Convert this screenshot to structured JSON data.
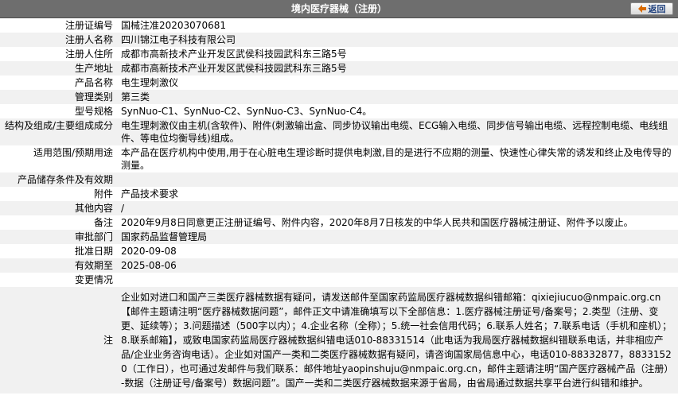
{
  "header": {
    "title": "境内医疗器械（注册）",
    "back_label": "返回"
  },
  "rows": [
    {
      "label": "注册证编号",
      "value": "国械注准20203070681"
    },
    {
      "label": "注册人名称",
      "value": "四川锦江电子科技有限公司"
    },
    {
      "label": "注册人住所",
      "value": "成都市高新技术产业开发区武侯科技园武科东三路5号"
    },
    {
      "label": "生产地址",
      "value": "成都市高新技术产业开发区武侯科技园武科东三路5号"
    },
    {
      "label": "产品名称",
      "value": "电生理刺激仪"
    },
    {
      "label": "管理类别",
      "value": "第三类"
    },
    {
      "label": "型号规格",
      "value": "SynNuo-C1、SynNuo-C2、SynNuo-C3、SynNuo-C4。"
    },
    {
      "label": "结构及组成/主要组成成分",
      "value": "电生理刺激仪由主机(含软件)、附件(刺激输出盒、同步协议输出电缆、ECG输入电缆、同步信号输出电缆、远程控制电缆、电线组件、等电位均衡导线)组成。"
    },
    {
      "label": "适用范围/预期用途",
      "value": "本产品在医疗机构中使用,用于在心脏电生理诊断时提供电刺激,目的是进行不应期的测量、快速性心律失常的诱发和终止及电传导的测量。"
    },
    {
      "label": "产品储存条件及有效期",
      "value": ""
    },
    {
      "label": "附件",
      "value": "产品技术要求"
    },
    {
      "label": "其他内容",
      "value": "/"
    },
    {
      "label": "备注",
      "value": "2020年9月8日同意更正注册证编号、附件内容，2020年8月7日核发的中华人民共和国医疗器械注册证、附件予以废止。"
    },
    {
      "label": "审批部门",
      "value": "国家药品监督管理局"
    },
    {
      "label": "批准日期",
      "value": "2020-09-08"
    },
    {
      "label": "有效期至",
      "value": "2025-08-06"
    },
    {
      "label": "变更情况",
      "value": ""
    }
  ],
  "note": {
    "label": "注",
    "text": "企业如对进口和国产三类医疗器械数据有疑问，请发送邮件至国家药监局医疗器械数据纠错邮箱：qixiejiucuo@nmpaic.org.cn【邮件主题请注明“医疗器械数据问题”，邮件正文中请准确填写以下全部信息：1.医疗器械注册证号/备案号；2.类型（注册、变更、延续等）；3.问题描述（500字以内）；4.企业名称（全称）；5.统一社会信用代码；6.联系人姓名；7.联系电话（手机和座机）；8.联系邮箱】，或致电国家药监局医疗器械数据纠错电话010-88331514（此电话为我局医疗器械数据纠错联系电话，并非相应产品/企业业务咨询电话）。企业如对国产一类和二类医疗器械数据有疑问，请咨询国家局信息中心，电话010-88332877，88331520（工作日），也可通过发邮件与我们联系：邮件地址yaopinshuju@nmpaic.org.cn，邮件主题请注明“国产医疗器械产品（注册）-数据（注册证号/备案号）数据问题”。国产一类和二类医疗器械数据来源于省局，由省局通过数据共享平台进行纠错和维护。"
  }
}
